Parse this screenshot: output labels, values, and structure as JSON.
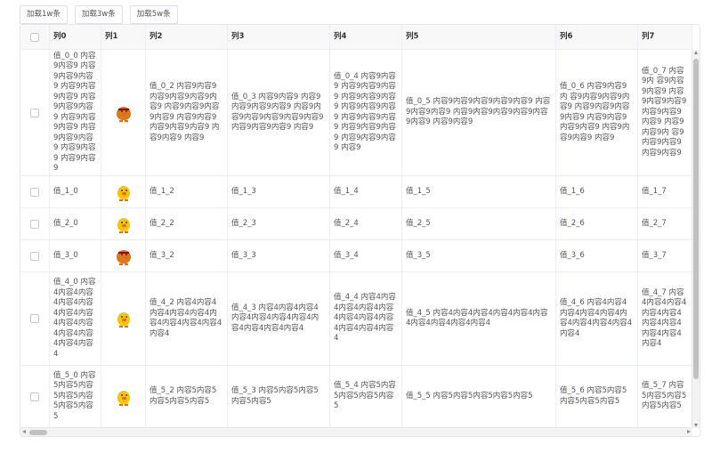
{
  "toolbar": {
    "load_1w": "加载1w条",
    "load_3w": "加载3w条",
    "load_5w": "加载5w条"
  },
  "columns": [
    "列0",
    "列1",
    "列2",
    "列3",
    "列4",
    "列5",
    "列6",
    "列7"
  ],
  "rows": [
    {
      "c0": "值_0_0 内容9内容9 内容9内容9内容9 内容9内容9内容9 内容9内容9内容9 内容9内容9内容9 内容9内容9内容9 内容9内容9 内容9内容9",
      "avatar": "angry-chick-icon",
      "c2": "值_0_2 内容9内容9 内容9内容9内容9内容9 内容9内容9内容9内容9 内容9内容9内容9内容9内容9 内容9内容9 内容9",
      "c3": "值_0_3 内容9内容9 内容9内容9内容9内容9 内容9内容9内容9内容9内容9内容9 内容9内容9内容9 内容9",
      "c4": "值_0_4 内容9内容9 内容9内容9内容9 内容9内容9内容9 内容9内容9内容9 内容9内容9内容9 内容9内容9内容9 内容9内容9内容9 内容9",
      "c5": "值_0_5 内容9内容9内容9内容9内容9 内容9内容9内容9 内容9内容9内容9内容9内容9内容9 内容9内容9",
      "c6": "值_0_6 内容9内容9内 容9内容9内容9内容9 内容9内容9内容9内容9 内容9内容9内容9内容9 内容9内容9内容9 内容9",
      "c7": "值_0_7 内容9内 容9内容9内容9 内容9内容9内容9 内容9内容9内容9 内容9内容9内 容9内容9内容9 内容9内容9"
    },
    {
      "c0": "值_1_0",
      "avatar": "chick-icon",
      "c2": "值_1_2",
      "c3": "值_1_3",
      "c4": "值_1_4",
      "c5": "值_1_5",
      "c6": "值_1_6",
      "c7": "值_1_7"
    },
    {
      "c0": "值_2_0",
      "avatar": "chick-icon",
      "c2": "值_2_2",
      "c3": "值_2_3",
      "c4": "值_2_4",
      "c5": "值_2_5",
      "c6": "值_2_6",
      "c7": "值_2_7"
    },
    {
      "c0": "值_3_0",
      "avatar": "angry-chick-icon",
      "c2": "值_3_2",
      "c3": "值_3_3",
      "c4": "值_3_4",
      "c5": "值_3_5",
      "c6": "值_3_6",
      "c7": "值_3_7"
    },
    {
      "c0": "值_4_0 内容4内容4内容4内容4内容4内容4内容4内容4内容4内容4内容4内容4内容4",
      "avatar": "chick-icon",
      "c2": "值_4_2 内容4内容4内容4内容4内容4内容4内容4内容4内容4内容4",
      "c3": "值_4_3 内容4内容4内容4内容4内容4内容4内容4内容4内容4内容4内容4",
      "c4": "值_4_4 内容4内容4内容4内容4内容4内容4内容4内容4内容4内容4内容4",
      "c5": "值_4_5 内容4内容4内容4内容4内容4内容4内容4内容4内容4内容4",
      "c6": "值_4_6 内容4内容4内容4内容4内容4内容4内容4内容4内容4内容4",
      "c7": "值_4_7 内容4内容4内容4内容4内容4内容4内容4内容4内容4内容4"
    },
    {
      "c0": "值_5_0 内容5内容5内容5内容5内容5内容5内容5",
      "avatar": "chick-icon",
      "c2": "值_5_2 内容5内容5内容5内容5内容5",
      "c3": "值_5_3 内容5内容5内容5内容5内容5",
      "c4": "值_5_4 内容5内容5内容5内容5内容5",
      "c5": "值_5_5 内容5内容5内容5内容5内容5",
      "c6": "值_5_6 内容5内容5内容5内容5内容5",
      "c7": "值_5_7 内容5内容5内容5内容5内容5"
    }
  ]
}
